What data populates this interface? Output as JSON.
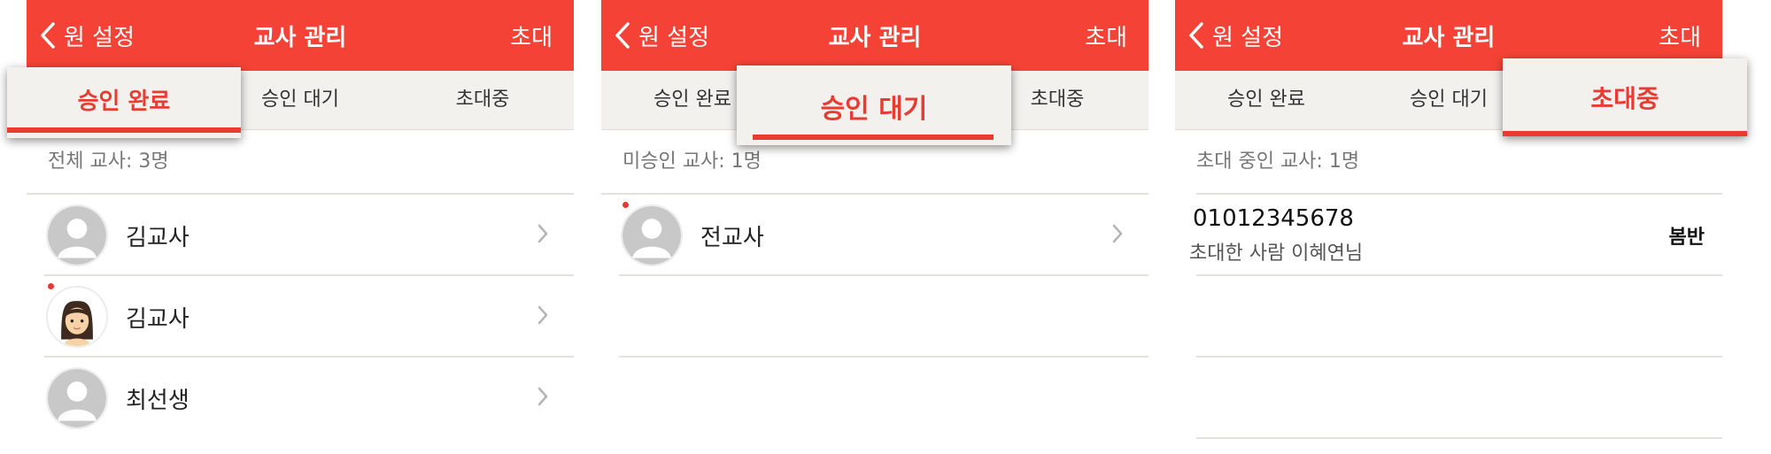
{
  "header": {
    "back_label": "원 설정",
    "title": "교사 관리",
    "invite_label": "초대"
  },
  "tabs": [
    "승인 완료",
    "승인 대기",
    "초대중"
  ],
  "colors": {
    "header": "#f44336",
    "accent": "#e83c33",
    "tab_bg": "#f3f1ee"
  },
  "approved": {
    "summary": "전체 교사: 3명",
    "teachers": [
      {
        "name": "김교사",
        "avatar": "default-avatar-icon",
        "new": false
      },
      {
        "name": "김교사",
        "avatar": "girl-avatar-icon",
        "new": true
      },
      {
        "name": "최선생",
        "avatar": "default-avatar-icon",
        "new": false
      }
    ]
  },
  "pending": {
    "summary": "미승인 교사: 1명",
    "teachers": [
      {
        "name": "전교사",
        "avatar": "default-avatar-icon",
        "new": true
      }
    ]
  },
  "inviting": {
    "summary": "초대 중인 교사: 1명",
    "invites": [
      {
        "phone": "01012345678",
        "inviter": "초대한 사람 이혜연님",
        "class_name": "봄반"
      }
    ]
  }
}
